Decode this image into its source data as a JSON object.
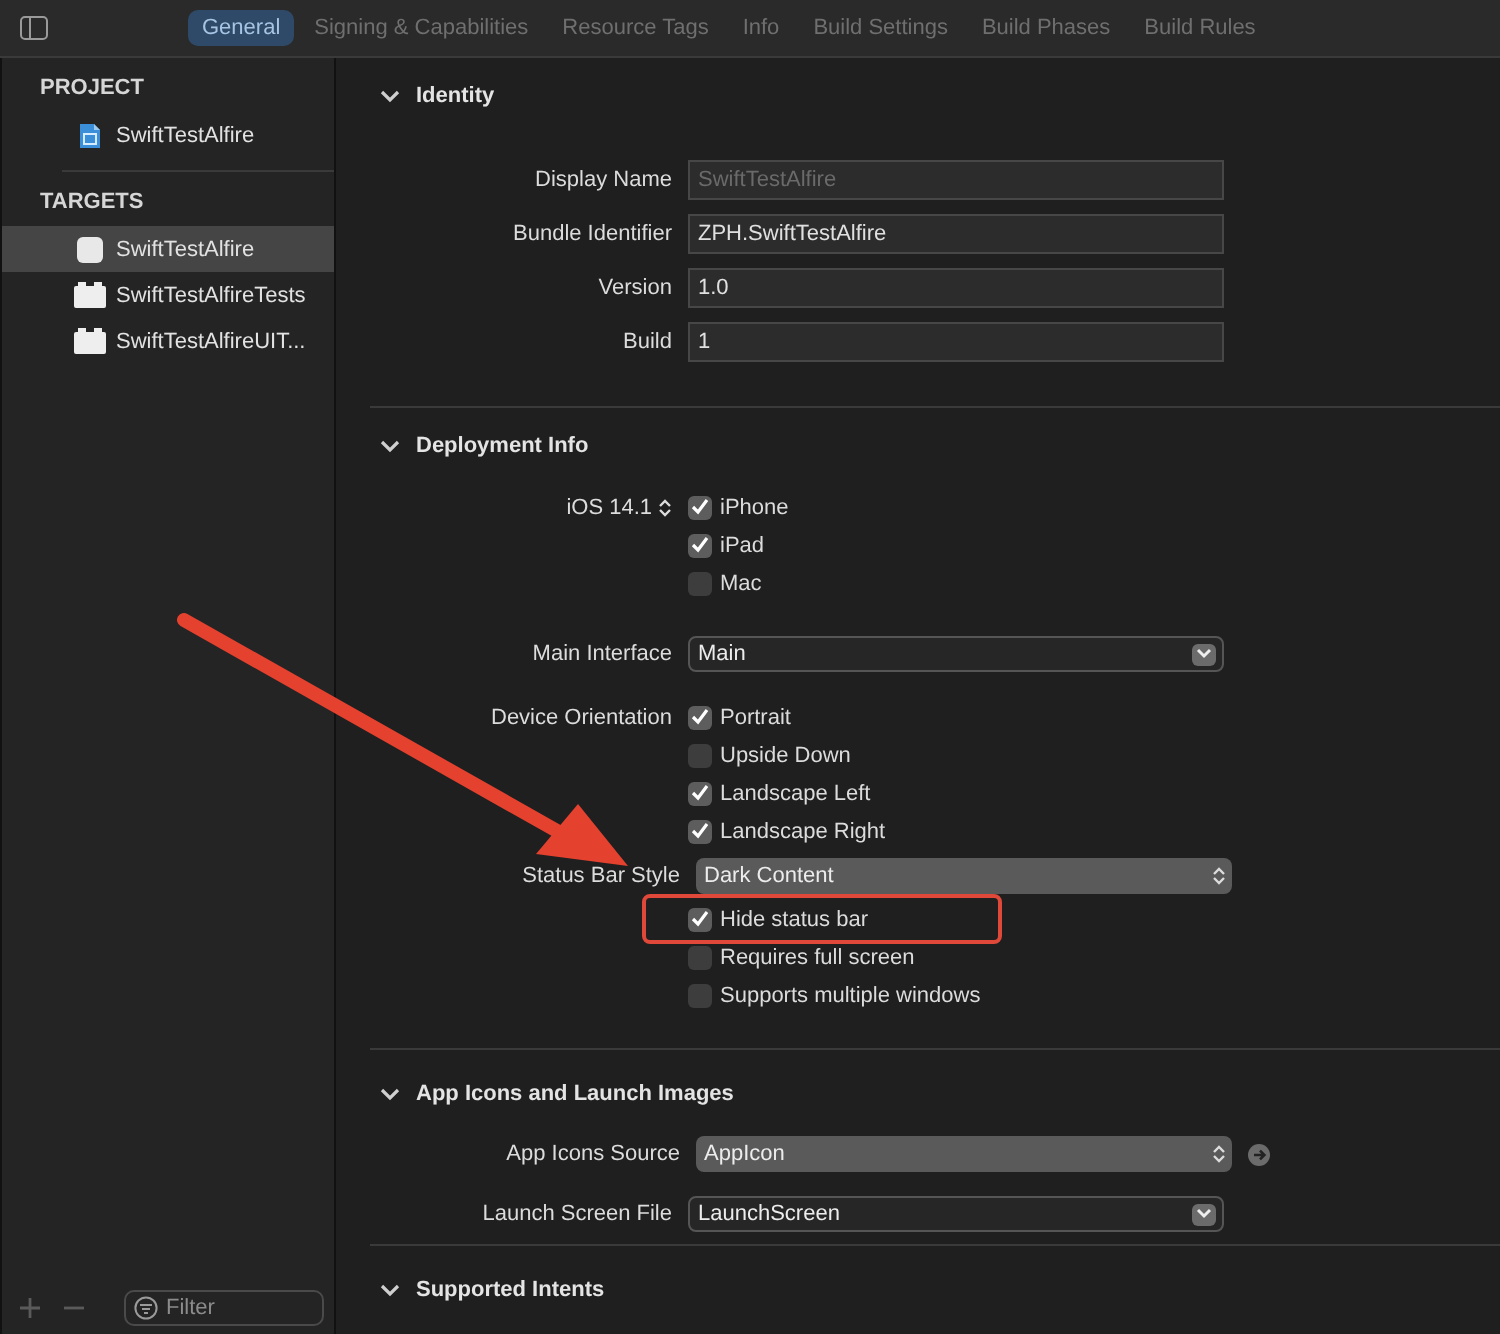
{
  "tabs": [
    {
      "label": "General",
      "selected": true
    },
    {
      "label": "Signing & Capabilities",
      "selected": false
    },
    {
      "label": "Resource Tags",
      "selected": false
    },
    {
      "label": "Info",
      "selected": false
    },
    {
      "label": "Build Settings",
      "selected": false
    },
    {
      "label": "Build Phases",
      "selected": false
    },
    {
      "label": "Build Rules",
      "selected": false
    }
  ],
  "sidebar": {
    "groups": [
      {
        "title": "PROJECT",
        "items": [
          {
            "label": "SwiftTestAlfire",
            "kind": "project",
            "selected": false
          }
        ]
      },
      {
        "title": "TARGETS",
        "items": [
          {
            "label": "SwiftTestAlfire",
            "kind": "app",
            "selected": true
          },
          {
            "label": "SwiftTestAlfireTests",
            "kind": "bundle",
            "selected": false
          },
          {
            "label": "SwiftTestAlfireUIT...",
            "kind": "bundle",
            "selected": false
          }
        ]
      }
    ],
    "filter": {
      "placeholder": "Filter"
    }
  },
  "sections": [
    {
      "title": "Identity",
      "expanded": true,
      "rows": [
        {
          "kind": "text",
          "label": "Display Name",
          "value": "SwiftTestAlfire",
          "disabled": true
        },
        {
          "kind": "text",
          "label": "Bundle Identifier",
          "value": "ZPH.SwiftTestAlfire",
          "disabled": false
        },
        {
          "kind": "text",
          "label": "Version",
          "value": "1.0",
          "disabled": false
        },
        {
          "kind": "text",
          "label": "Build",
          "value": "1",
          "disabled": false
        }
      ]
    },
    {
      "title": "Deployment Info",
      "expanded": true,
      "rows": [
        {
          "kind": "checks",
          "label": "iOS 14.1",
          "label_popup": true,
          "options": [
            {
              "label": "iPhone",
              "checked": true,
              "highlighted": false
            },
            {
              "label": "iPad",
              "checked": true,
              "highlighted": false
            },
            {
              "label": "Mac",
              "checked": false,
              "highlighted": false
            }
          ]
        },
        {
          "kind": "combo",
          "label": "Main Interface",
          "value": "Main"
        },
        {
          "kind": "checks",
          "label": "Device Orientation",
          "options": [
            {
              "label": "Portrait",
              "checked": true,
              "highlighted": false
            },
            {
              "label": "Upside Down",
              "checked": false,
              "highlighted": false
            },
            {
              "label": "Landscape Left",
              "checked": true,
              "highlighted": false
            },
            {
              "label": "Landscape Right",
              "checked": true,
              "highlighted": false
            }
          ]
        },
        {
          "kind": "popup",
          "label": "Status Bar Style",
          "value": "Dark Content"
        },
        {
          "kind": "checks",
          "options": [
            {
              "label": "Hide status bar",
              "checked": true,
              "highlighted": true
            },
            {
              "label": "Requires full screen",
              "checked": false,
              "highlighted": false
            },
            {
              "label": "Supports multiple windows",
              "checked": false,
              "highlighted": false
            }
          ]
        }
      ]
    },
    {
      "title": "App Icons and Launch Images",
      "expanded": true,
      "rows": [
        {
          "kind": "popup",
          "label": "App Icons Source",
          "value": "AppIcon",
          "go_button": true
        },
        {
          "kind": "combo",
          "label": "Launch Screen File",
          "value": "LaunchScreen"
        }
      ]
    },
    {
      "title": "Supported Intents",
      "expanded": true
    }
  ]
}
